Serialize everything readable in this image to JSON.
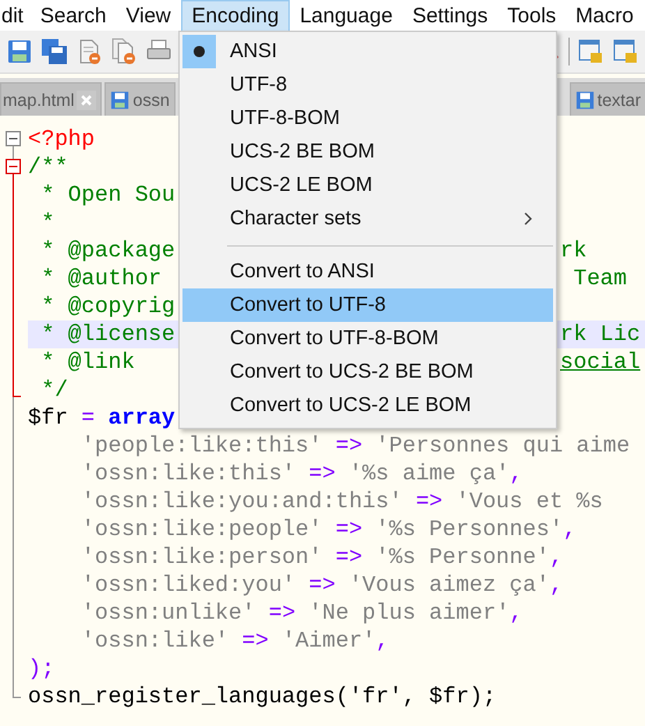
{
  "menubar": [
    {
      "label": "dit",
      "selected": false
    },
    {
      "label": "Search",
      "selected": false
    },
    {
      "label": "View",
      "selected": false
    },
    {
      "label": "Encoding",
      "selected": true
    },
    {
      "label": "Language",
      "selected": false
    },
    {
      "label": "Settings",
      "selected": false
    },
    {
      "label": "Tools",
      "selected": false
    },
    {
      "label": "Macro",
      "selected": false
    }
  ],
  "tabs": [
    {
      "label": "map.html",
      "kind": "closable"
    },
    {
      "label": "ossn",
      "kind": "saved"
    }
  ],
  "right_tabs": [
    {
      "label": "textar",
      "kind": "saved"
    }
  ],
  "menu": [
    {
      "kind": "radio",
      "label": "ANSI",
      "checked": true,
      "selected": false
    },
    {
      "kind": "radio",
      "label": "UTF-8",
      "checked": false,
      "selected": false
    },
    {
      "kind": "radio",
      "label": "UTF-8-BOM",
      "checked": false,
      "selected": false
    },
    {
      "kind": "radio",
      "label": "UCS-2 BE BOM",
      "checked": false,
      "selected": false
    },
    {
      "kind": "radio",
      "label": "UCS-2 LE BOM",
      "checked": false,
      "selected": false
    },
    {
      "kind": "submenu",
      "label": "Character sets",
      "selected": false
    },
    {
      "kind": "separator"
    },
    {
      "kind": "item",
      "label": "Convert to ANSI",
      "selected": false
    },
    {
      "kind": "item",
      "label": "Convert to UTF-8",
      "selected": true
    },
    {
      "kind": "item",
      "label": "Convert to UTF-8-BOM",
      "selected": false
    },
    {
      "kind": "item",
      "label": "Convert to UCS-2 BE BOM",
      "selected": false
    },
    {
      "kind": "item",
      "label": "Convert to UCS-2 LE BOM",
      "selected": false
    }
  ],
  "editor": {
    "lines": [
      {
        "kind": "box",
        "highlighted": false,
        "tokens": [
          {
            "kind": "tag",
            "text": "<?php"
          }
        ]
      },
      {
        "kind": "box-red",
        "highlighted": false,
        "tokens": [
          {
            "kind": "comment",
            "text": "/**"
          }
        ]
      },
      {
        "kind": "bar-red",
        "highlighted": false,
        "tokens": [
          {
            "kind": "comment",
            "text": " * Open Sou"
          }
        ]
      },
      {
        "kind": "bar-red",
        "highlighted": false,
        "tokens": [
          {
            "kind": "comment",
            "text": " *"
          }
        ]
      },
      {
        "kind": "bar-red",
        "highlighted": false,
        "tokens": [
          {
            "kind": "comment",
            "text": " * @package"
          }
        ],
        "right": [
          {
            "kind": "comment",
            "text": "rk"
          }
        ]
      },
      {
        "kind": "bar-red",
        "highlighted": false,
        "tokens": [
          {
            "kind": "comment",
            "text": " * @author"
          }
        ],
        "right": [
          {
            "kind": "comment",
            "text": " Team"
          }
        ]
      },
      {
        "kind": "bar-red",
        "highlighted": false,
        "tokens": [
          {
            "kind": "comment",
            "text": " * @copyrig"
          }
        ]
      },
      {
        "kind": "bar-red",
        "highlighted": true,
        "tokens": [
          {
            "kind": "comment",
            "text": " * @license"
          }
        ],
        "right": [
          {
            "kind": "comment",
            "text": "rk Lic"
          }
        ]
      },
      {
        "kind": "bar-red",
        "highlighted": false,
        "tokens": [
          {
            "kind": "comment",
            "text": " * @link"
          }
        ],
        "right": [
          {
            "kind": "link",
            "text": "social"
          }
        ]
      },
      {
        "kind": "end-red",
        "highlighted": false,
        "tokens": [
          {
            "kind": "comment",
            "text": " */"
          }
        ]
      },
      {
        "kind": "bar",
        "highlighted": false,
        "tokens": [
          {
            "kind": "var",
            "text": "$fr"
          },
          {
            "kind": "op",
            "text": " = "
          },
          {
            "kind": "keyword",
            "text": "array"
          }
        ]
      },
      {
        "kind": "bar",
        "highlighted": false,
        "tokens": [
          {
            "kind": "string",
            "text": "    'people:like:this'"
          },
          {
            "kind": "op",
            "text": " => "
          },
          {
            "kind": "string",
            "text": "'Personnes qui aime"
          }
        ]
      },
      {
        "kind": "bar",
        "highlighted": false,
        "tokens": [
          {
            "kind": "string",
            "text": "    'ossn:like:this'"
          },
          {
            "kind": "op",
            "text": " => "
          },
          {
            "kind": "string",
            "text": "'%s aime ça'"
          },
          {
            "kind": "op",
            "text": ","
          }
        ]
      },
      {
        "kind": "bar",
        "highlighted": false,
        "tokens": [
          {
            "kind": "string",
            "text": "    'ossn:like:you:and:this'"
          },
          {
            "kind": "op",
            "text": " => "
          },
          {
            "kind": "string",
            "text": "'Vous et %s"
          }
        ]
      },
      {
        "kind": "bar",
        "highlighted": false,
        "tokens": [
          {
            "kind": "string",
            "text": "    'ossn:like:people'"
          },
          {
            "kind": "op",
            "text": " => "
          },
          {
            "kind": "string",
            "text": "'%s Personnes'"
          },
          {
            "kind": "op",
            "text": ","
          }
        ]
      },
      {
        "kind": "bar",
        "highlighted": false,
        "tokens": [
          {
            "kind": "string",
            "text": "    'ossn:like:person'"
          },
          {
            "kind": "op",
            "text": " => "
          },
          {
            "kind": "string",
            "text": "'%s Personne'"
          },
          {
            "kind": "op",
            "text": ","
          }
        ]
      },
      {
        "kind": "bar",
        "highlighted": false,
        "tokens": [
          {
            "kind": "string",
            "text": "    'ossn:liked:you'"
          },
          {
            "kind": "op",
            "text": " => "
          },
          {
            "kind": "string",
            "text": "'Vous aimez ça'"
          },
          {
            "kind": "op",
            "text": ","
          }
        ]
      },
      {
        "kind": "bar",
        "highlighted": false,
        "tokens": [
          {
            "kind": "string",
            "text": "    'ossn:unlike'"
          },
          {
            "kind": "op",
            "text": " => "
          },
          {
            "kind": "string",
            "text": "'Ne plus aimer'"
          },
          {
            "kind": "op",
            "text": ","
          }
        ]
      },
      {
        "kind": "bar",
        "highlighted": false,
        "tokens": [
          {
            "kind": "string",
            "text": "    'ossn:like'"
          },
          {
            "kind": "op",
            "text": " => "
          },
          {
            "kind": "string",
            "text": "'Aimer'"
          },
          {
            "kind": "op",
            "text": ","
          }
        ]
      },
      {
        "kind": "bar",
        "highlighted": false,
        "tokens": [
          {
            "kind": "op",
            "text": ");"
          }
        ]
      },
      {
        "kind": "end",
        "highlighted": false,
        "tokens": [
          {
            "kind": "plain",
            "text": "ossn_register_languages('fr', $fr);"
          }
        ]
      }
    ]
  }
}
